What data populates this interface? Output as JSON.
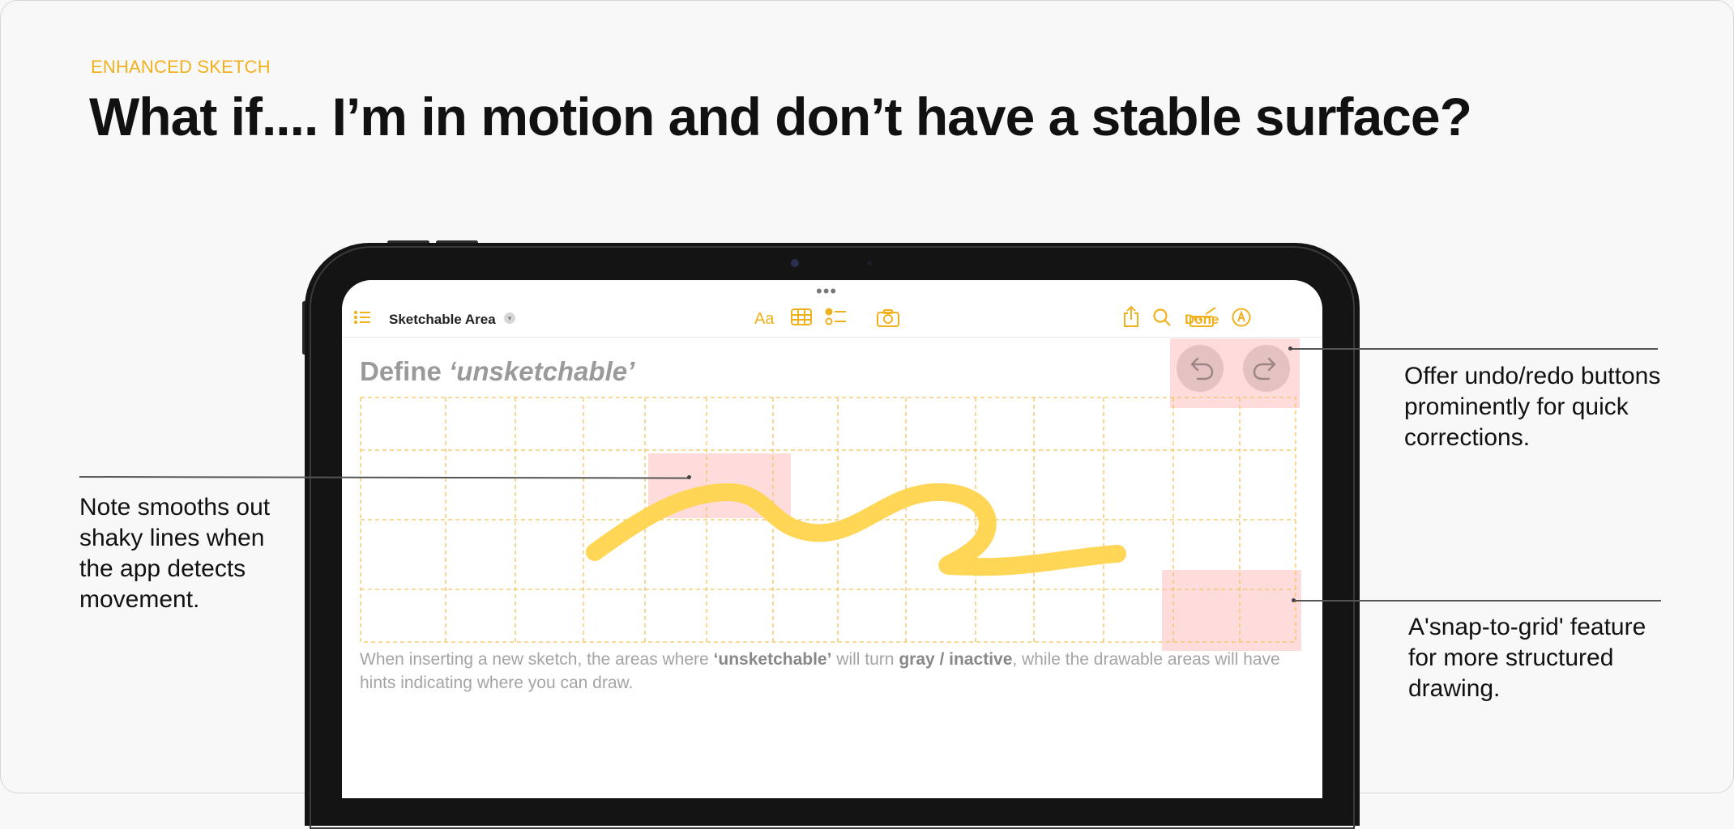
{
  "slide": {
    "eyebrow": "ENHANCED SKETCH",
    "headline": "What if....  I’m in motion and don’t have a stable surface?"
  },
  "toolbar": {
    "note_title": "Sketchable Area",
    "done_label": "Done",
    "left_icons": [
      "list-icon"
    ],
    "center_icons": [
      "text-format-icon",
      "table-icon",
      "checklist-icon",
      "camera-icon"
    ],
    "right_icons": [
      "share-icon",
      "search-icon",
      "ruler-icon",
      "markup-pen-icon"
    ],
    "accent_color": "#f1b11f"
  },
  "note": {
    "heading_prefix": "Define ",
    "heading_italic": "‘unsketchable’",
    "caption_1": "When inserting a new sketch, the areas where ",
    "caption_bold_1": "‘unsketchable’",
    "caption_2": " will turn ",
    "caption_bold_2": "gray / inactive",
    "caption_3": ", while the drawable areas will have hints indicating where you can draw."
  },
  "canvas": {
    "undo_icon": "undo-arrow-icon",
    "redo_icon": "redo-arrow-icon",
    "stroke_color": "#ffd44d",
    "grid_color": "#f3c35b",
    "highlight_color": "#ffd6d6"
  },
  "annotations": {
    "left": [
      "Note smooths out",
      "shaky lines when",
      "the app detects",
      "movement."
    ],
    "top_right": [
      "Offer undo/redo buttons",
      "prominently for quick",
      "corrections."
    ],
    "bottom_right": [
      "A'snap-to-grid' feature",
      "for more structured",
      "drawing."
    ]
  }
}
